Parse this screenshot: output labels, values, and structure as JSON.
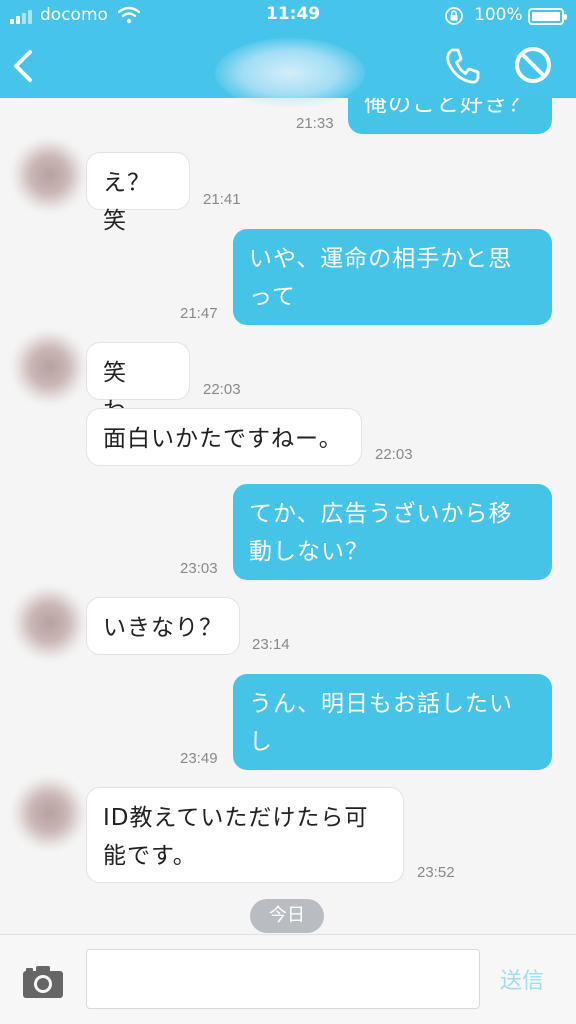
{
  "status_bar": {
    "carrier": "docomo",
    "time": "11:49",
    "battery": "100%"
  },
  "colors": {
    "accent": "#47c4ea",
    "outgoing_bubble": "#46c4e8",
    "incoming_bubble": "#ffffff",
    "background": "#f5f5f5"
  },
  "header": {
    "back_icon": "chevron-left-icon",
    "call_icon": "phone-icon",
    "block_icon": "block-icon"
  },
  "messages": [
    {
      "side": "out",
      "text": "俺のこと好き？",
      "time": "21:33"
    },
    {
      "side": "in",
      "text": "え？笑",
      "time": "21:41"
    },
    {
      "side": "out",
      "text": "いや、運命の相手かと思って",
      "time": "21:47"
    },
    {
      "side": "in",
      "text": "笑わ、",
      "time": "22:03"
    },
    {
      "side": "in",
      "text": "面白いかたですねー。",
      "time": "22:03"
    },
    {
      "side": "out",
      "text": "てか、広告うざいから移動しない？",
      "time": "23:03"
    },
    {
      "side": "in",
      "text": "いきなり？",
      "time": "23:14"
    },
    {
      "side": "out",
      "text": "うん、明日もお話したいし",
      "time": "23:49"
    },
    {
      "side": "in",
      "text": "ID教えていただけたら可能です。",
      "time": "23:52"
    }
  ],
  "day_divider": "今日",
  "composer": {
    "camera_icon": "camera-icon",
    "input_value": "",
    "send_label": "送信"
  }
}
